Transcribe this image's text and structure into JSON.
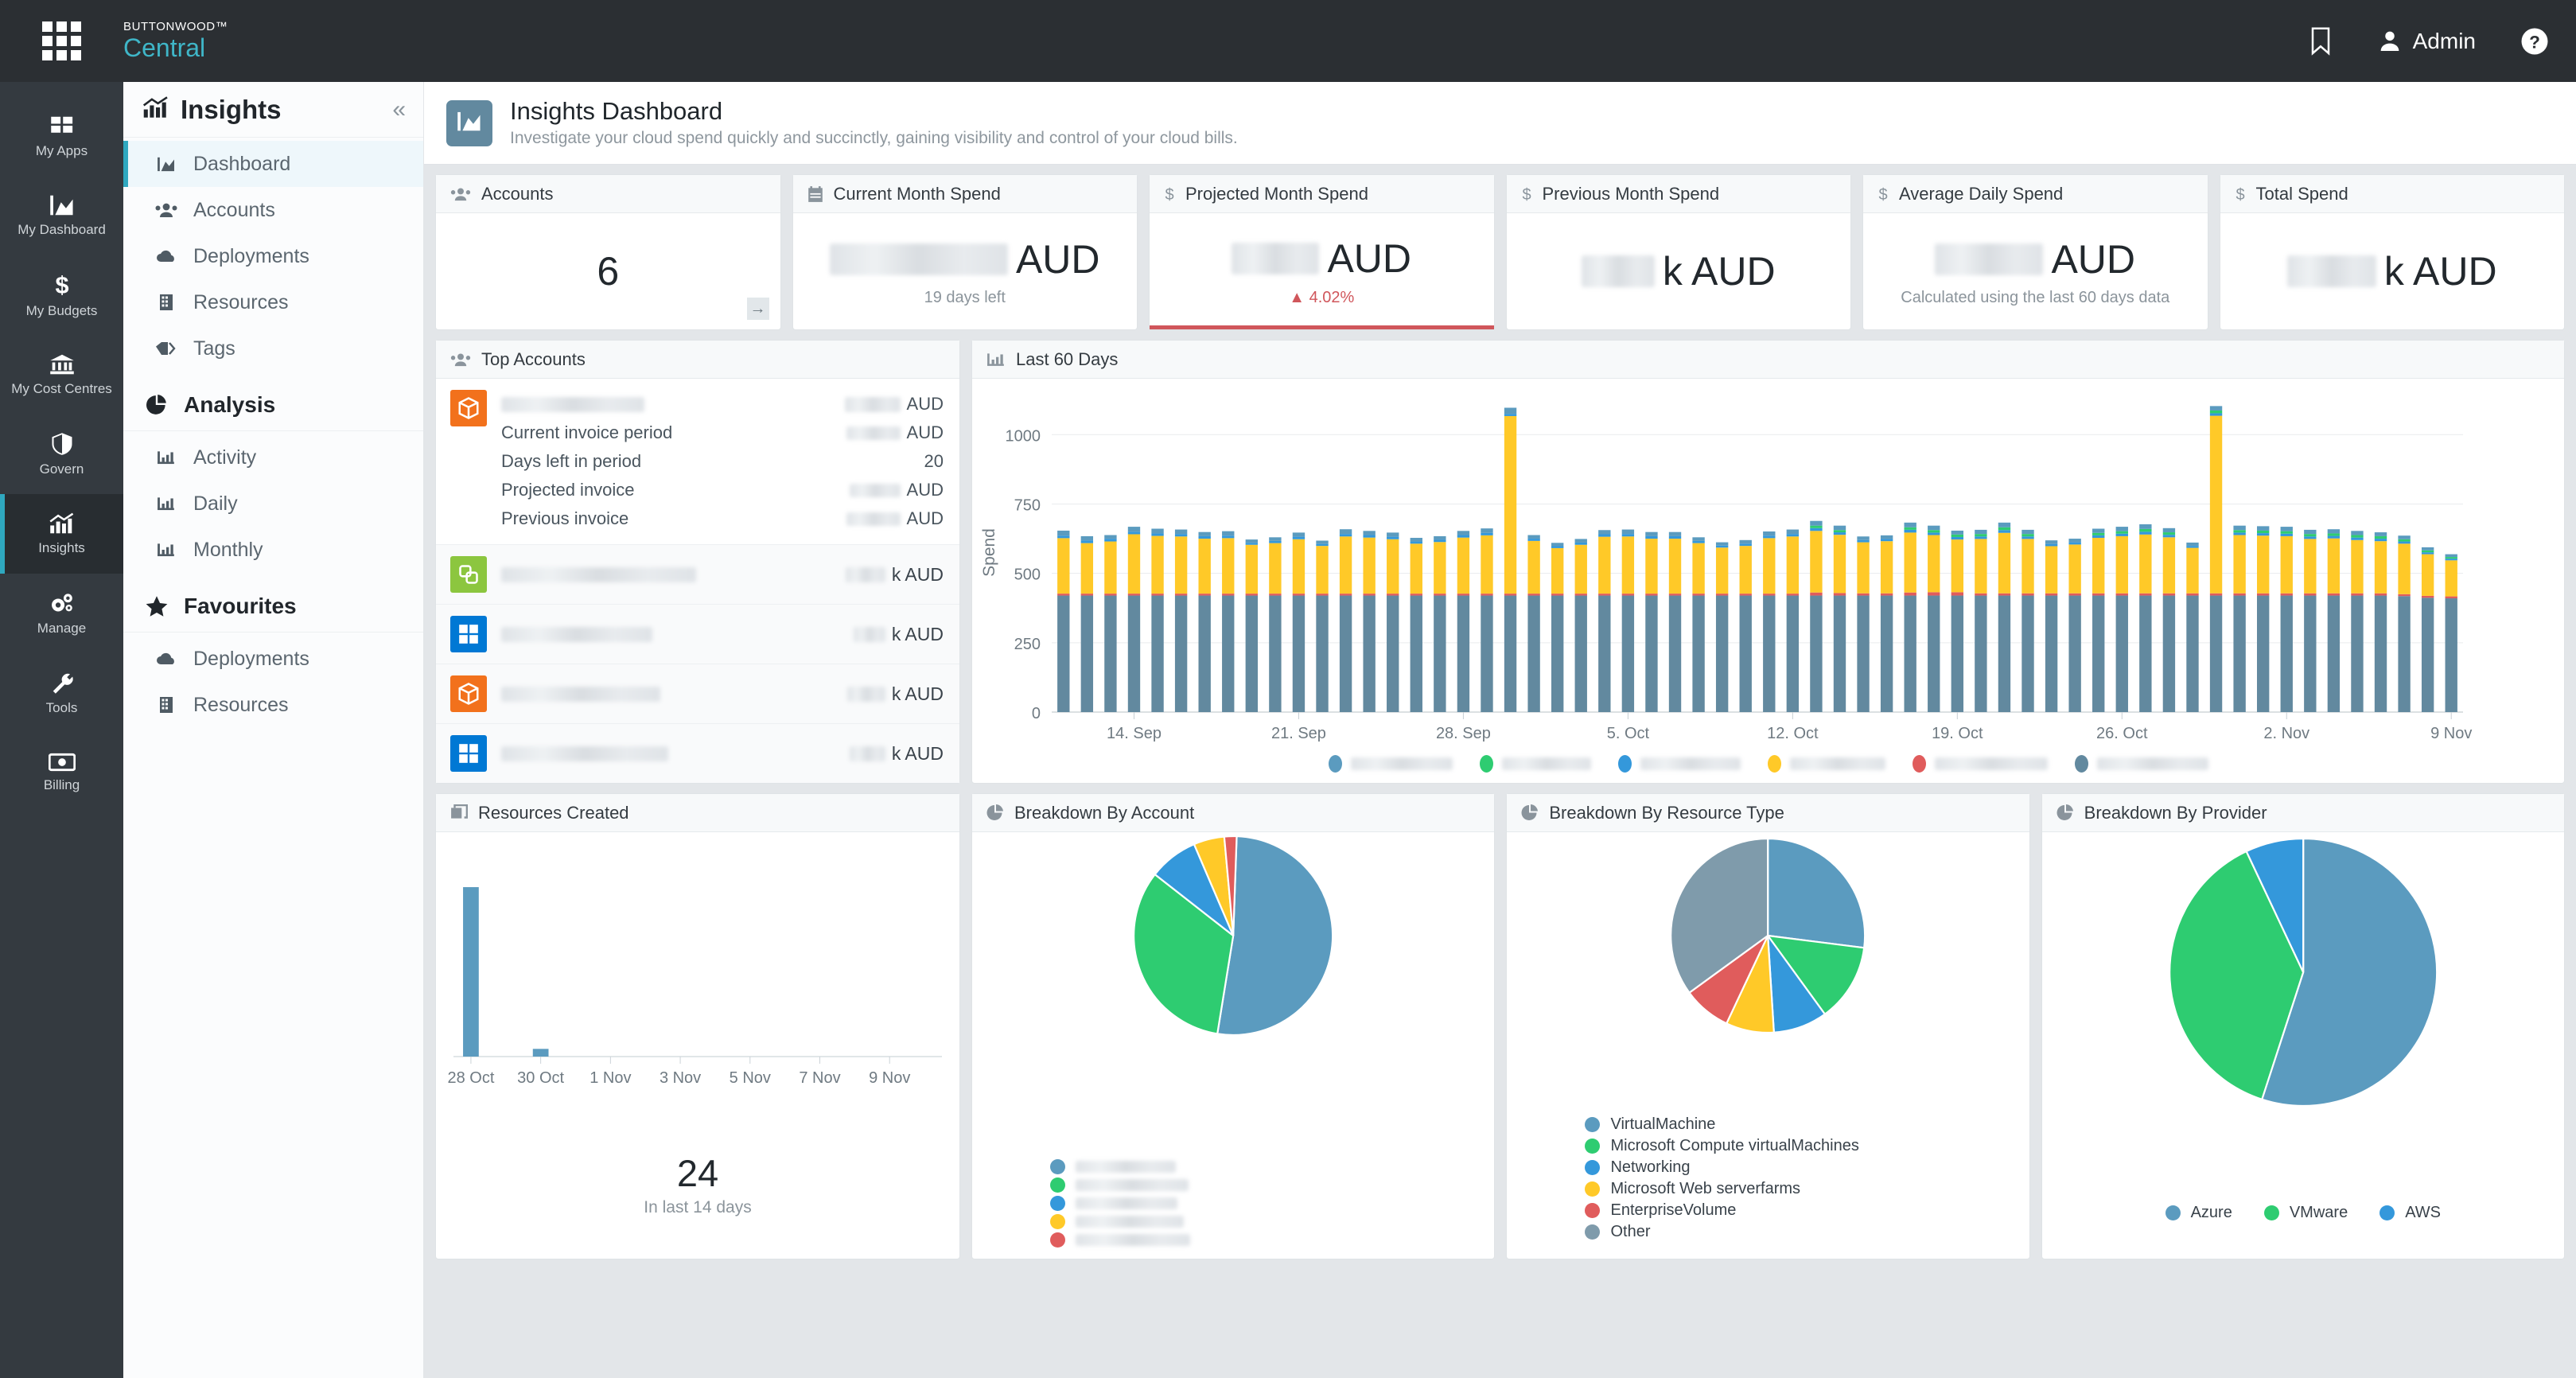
{
  "topbar": {
    "brand_top": "BUTTONWOOD™",
    "brand_main": "Central",
    "bookmark_label": "bookmark-icon",
    "user_label": "Admin",
    "help_label": "help-icon"
  },
  "rail": {
    "items": [
      {
        "label": "My Apps",
        "icon": "apps-icon",
        "active": false
      },
      {
        "label": "My Dashboard",
        "icon": "area-chart-icon",
        "active": false
      },
      {
        "label": "My Budgets",
        "icon": "dollar-icon",
        "active": false
      },
      {
        "label": "My Cost Centres",
        "icon": "bank-icon",
        "active": false
      },
      {
        "label": "Govern",
        "icon": "shield-icon",
        "active": false
      },
      {
        "label": "Insights",
        "icon": "bar-chart-icon",
        "active": true
      },
      {
        "label": "Manage",
        "icon": "gears-icon",
        "active": false
      },
      {
        "label": "Tools",
        "icon": "wrench-icon",
        "active": false
      },
      {
        "label": "Billing",
        "icon": "money-icon",
        "active": false
      }
    ]
  },
  "sidebar": {
    "title": "Insights",
    "collapse_glyph": "«",
    "items": [
      {
        "label": "Dashboard",
        "icon": "area-chart-icon",
        "active": true
      },
      {
        "label": "Accounts",
        "icon": "users-icon",
        "active": false
      },
      {
        "label": "Deployments",
        "icon": "cloud-icon",
        "active": false
      },
      {
        "label": "Resources",
        "icon": "building-icon",
        "active": false
      },
      {
        "label": "Tags",
        "icon": "tags-icon",
        "active": false
      }
    ],
    "analysis": {
      "title": "Analysis",
      "icon": "pie-chart-icon",
      "items": [
        {
          "label": "Activity",
          "icon": "bar-chart-icon"
        },
        {
          "label": "Daily",
          "icon": "bar-chart-icon"
        },
        {
          "label": "Monthly",
          "icon": "bar-chart-icon"
        }
      ]
    },
    "favourites": {
      "title": "Favourites",
      "icon": "star-icon",
      "items": [
        {
          "label": "Deployments",
          "icon": "cloud-icon"
        },
        {
          "label": "Resources",
          "icon": "building-icon"
        }
      ]
    }
  },
  "page": {
    "title": "Insights Dashboard",
    "subtitle": "Investigate your cloud spend quickly and succinctly, gaining visibility and control of your cloud bills.",
    "icon": "area-chart-icon"
  },
  "kpis": [
    {
      "title": "Accounts",
      "icon": "users-icon",
      "value": "6",
      "redacted": false,
      "sub": "",
      "delta": "",
      "arrow": true
    },
    {
      "title": "Current Month Spend",
      "icon": "calendar-icon",
      "value": "",
      "redacted": true,
      "redacted_width": 224,
      "unit": "AUD",
      "sub": "19 days left",
      "delta": "",
      "arrow": false
    },
    {
      "title": "Projected Month Spend",
      "icon": "dollar-icon",
      "value": "",
      "redacted": true,
      "redacted_width": 110,
      "unit": "AUD",
      "sub": "",
      "delta": "▲ 4.02%",
      "accent": true,
      "arrow": false
    },
    {
      "title": "Previous Month Spend",
      "icon": "dollar-icon",
      "value": "",
      "redacted": true,
      "redacted_width": 92,
      "unit": "k AUD",
      "sub": "",
      "delta": "",
      "arrow": false
    },
    {
      "title": "Average Daily Spend",
      "icon": "dollar-icon",
      "value": "",
      "redacted": true,
      "redacted_width": 136,
      "unit": "AUD",
      "sub": "Calculated using the last 60 days data",
      "delta": "",
      "arrow": false
    },
    {
      "title": "Total Spend",
      "icon": "dollar-icon",
      "value": "",
      "redacted": true,
      "redacted_width": 112,
      "unit": "k AUD",
      "sub": "",
      "delta": "",
      "arrow": false
    }
  ],
  "top_accounts": {
    "title": "Top Accounts",
    "icon": "users-icon",
    "primary": {
      "icon_color": "orange",
      "name_redacted_width": 180,
      "amount_redacted_width": 70,
      "amount_unit": "AUD",
      "details": [
        {
          "label": "Current invoice period",
          "value": "",
          "redacted": true,
          "redacted_width": 68,
          "unit": "AUD"
        },
        {
          "label": "Days left in period",
          "value": "20",
          "redacted": false,
          "unit": ""
        },
        {
          "label": "Projected invoice",
          "value": "",
          "redacted": true,
          "redacted_width": 64,
          "unit": "AUD"
        },
        {
          "label": "Previous invoice",
          "value": "",
          "redacted": true,
          "redacted_width": 68,
          "unit": "AUD"
        }
      ]
    },
    "rows": [
      {
        "icon_color": "green",
        "name_redacted_width": 245,
        "amount_redacted_width": 50,
        "unit": "k AUD"
      },
      {
        "icon_color": "blue",
        "name_redacted_width": 190,
        "amount_redacted_width": 40,
        "unit": "k AUD"
      },
      {
        "icon_color": "orange",
        "name_redacted_width": 200,
        "amount_redacted_width": 48,
        "unit": "k AUD"
      },
      {
        "icon_color": "blue",
        "name_redacted_width": 210,
        "amount_redacted_width": 45,
        "unit": "k AUD"
      }
    ]
  },
  "resources_created": {
    "title": "Resources Created",
    "icon": "copy-icon",
    "count": "24",
    "count_sub": "In last 14 days"
  },
  "breakdown_account": {
    "title": "Breakdown By Account",
    "icon": "pie-chart-icon"
  },
  "breakdown_resource": {
    "title": "Breakdown By Resource Type",
    "icon": "pie-chart-icon"
  },
  "breakdown_provider": {
    "title": "Breakdown By Provider",
    "icon": "pie-chart-icon"
  },
  "chart_data": [
    {
      "id": "last60",
      "type": "bar",
      "stacked": true,
      "title": "Last 60 Days",
      "icon": "bar-chart-icon",
      "xlabel": "",
      "ylabel": "Spend",
      "ylim": [
        0,
        1150
      ],
      "yticks": [
        0,
        250,
        500,
        750,
        1000
      ],
      "grid": true,
      "legend_position": "bottom",
      "legend_redacted": true,
      "legend": [
        {
          "label": "",
          "color": "#5b9bbf",
          "redacted_width": 128
        },
        {
          "label": "",
          "color": "#2ecc71",
          "redacted_width": 112
        },
        {
          "label": "",
          "color": "#3498db",
          "redacted_width": 126
        },
        {
          "label": "",
          "color": "#ffc928",
          "redacted_width": 120
        },
        {
          "label": "",
          "color": "#e05c5c",
          "redacted_width": 142
        },
        {
          "label": "",
          "color": "#62899f",
          "redacted_width": 140
        }
      ],
      "x_tick_labels": [
        "14. Sep",
        "21. Sep",
        "28. Sep",
        "5. Oct",
        "12. Oct",
        "19. Oct",
        "26. Oct",
        "2. Nov",
        "9 Nov"
      ],
      "x_tick_indices": [
        3,
        10,
        17,
        24,
        31,
        38,
        45,
        52,
        59
      ],
      "series": [
        {
          "name": "base",
          "color": "#62899f",
          "values": [
            420,
            420,
            420,
            420,
            420,
            420,
            420,
            420,
            420,
            420,
            420,
            420,
            420,
            420,
            420,
            420,
            420,
            420,
            420,
            420,
            420,
            420,
            420,
            420,
            420,
            420,
            420,
            420,
            420,
            420,
            420,
            420,
            420,
            420,
            420,
            420,
            420,
            420,
            420,
            420,
            420,
            420,
            420,
            420,
            420,
            420,
            420,
            420,
            420,
            420,
            420,
            420,
            420,
            420,
            420,
            420,
            420,
            418,
            412,
            410
          ]
        },
        {
          "name": "enterprise",
          "color": "#e05c5c",
          "values": [
            7,
            7,
            7,
            7,
            7,
            7,
            7,
            7,
            7,
            7,
            7,
            7,
            7,
            7,
            7,
            7,
            7,
            7,
            7,
            7,
            7,
            7,
            7,
            7,
            7,
            7,
            7,
            7,
            7,
            7,
            7,
            7,
            11,
            9,
            8,
            8,
            11,
            12,
            12,
            8,
            8,
            8,
            8,
            8,
            8,
            8,
            8,
            8,
            8,
            8,
            8,
            8,
            8,
            8,
            8,
            8,
            8,
            7,
            7,
            7
          ]
        },
        {
          "name": "web",
          "color": "#ffc928",
          "values": [
            200,
            182,
            188,
            214,
            208,
            206,
            198,
            200,
            176,
            182,
            196,
            172,
            206,
            202,
            196,
            180,
            186,
            202,
            210,
            640,
            190,
            164,
            176,
            205,
            206,
            198,
            198,
            182,
            166,
            172,
            200,
            206,
            222,
            210,
            184,
            188,
            216,
            206,
            190,
            196,
            218,
            196,
            170,
            176,
            200,
            206,
            212,
            202,
            164,
            640,
            210,
            208,
            206,
            196,
            198,
            192,
            188,
            182,
            150,
            130
          ]
        },
        {
          "name": "networking",
          "color": "#3498db",
          "values": [
            9,
            10,
            9,
            9,
            9,
            9,
            9,
            9,
            7,
            8,
            9,
            7,
            9,
            9,
            9,
            8,
            8,
            9,
            9,
            8,
            8,
            7,
            8,
            9,
            9,
            9,
            9,
            8,
            7,
            8,
            9,
            9,
            10,
            9,
            8,
            8,
            10,
            9,
            9,
            9,
            10,
            9,
            8,
            8,
            9,
            9,
            10,
            9,
            7,
            9,
            9,
            9,
            9,
            9,
            9,
            9,
            9,
            8,
            7,
            6
          ]
        },
        {
          "name": "compute",
          "color": "#2ecc71",
          "values": [
            0,
            0,
            0,
            0,
            0,
            0,
            0,
            0,
            0,
            0,
            0,
            0,
            0,
            0,
            0,
            0,
            0,
            0,
            0,
            0,
            0,
            0,
            0,
            0,
            0,
            0,
            0,
            0,
            0,
            0,
            0,
            0,
            9,
            8,
            0,
            0,
            9,
            9,
            9,
            9,
            10,
            9,
            0,
            0,
            9,
            9,
            10,
            9,
            0,
            10,
            9,
            9,
            9,
            9,
            9,
            9,
            9,
            8,
            7,
            6
          ]
        },
        {
          "name": "vm",
          "color": "#5b9bbf",
          "values": [
            18,
            15,
            14,
            18,
            17,
            16,
            15,
            16,
            12,
            13,
            15,
            12,
            17,
            15,
            15,
            13,
            13,
            15,
            16,
            22,
            13,
            12,
            13,
            15,
            16,
            15,
            15,
            13,
            12,
            13,
            15,
            16,
            17,
            16,
            13,
            13,
            17,
            16,
            14,
            15,
            17,
            15,
            13,
            13,
            15,
            16,
            17,
            15,
            12,
            16,
            16,
            16,
            16,
            15,
            15,
            15,
            14,
            13,
            11,
            10
          ]
        }
      ]
    },
    {
      "id": "resources_created",
      "type": "bar",
      "title": "Resources Created",
      "ylim": [
        0,
        25
      ],
      "grid": false,
      "x_tick_labels": [
        "28 Oct",
        "30 Oct",
        "1 Nov",
        "3 Nov",
        "5 Nov",
        "7 Nov",
        "9 Nov"
      ],
      "categories": [
        "28 Oct",
        "29 Oct",
        "30 Oct",
        "31 Oct",
        "1 Nov",
        "2 Nov",
        "3 Nov",
        "4 Nov",
        "5 Nov",
        "6 Nov",
        "7 Nov",
        "8 Nov",
        "9 Nov",
        "10 Nov"
      ],
      "values": [
        22,
        0,
        1,
        0,
        0,
        0,
        0,
        0,
        0,
        0,
        0,
        0,
        0,
        0
      ],
      "color": "#5b9bbf",
      "total": 24,
      "total_label": "In last 14 days"
    },
    {
      "id": "breakdown_account",
      "type": "pie",
      "title": "Breakdown By Account",
      "legend_redacted": true,
      "labels": [
        "",
        "",
        "",
        "",
        ""
      ],
      "values": [
        52,
        33,
        8,
        5,
        2
      ],
      "colors": [
        "#5b9bbf",
        "#2ecc71",
        "#3498db",
        "#ffc928",
        "#e05c5c"
      ],
      "legend_redacted_widths": [
        126,
        142,
        128,
        136,
        144
      ]
    },
    {
      "id": "breakdown_resource",
      "type": "pie",
      "title": "Breakdown By Resource Type",
      "labels": [
        "VirtualMachine",
        "Microsoft Compute virtualMachines",
        "Networking",
        "Microsoft Web serverfarms",
        "EnterpriseVolume",
        "Other"
      ],
      "values": [
        27,
        13,
        9,
        8,
        8,
        35
      ],
      "colors": [
        "#5b9bbf",
        "#2ecc71",
        "#3498db",
        "#ffc928",
        "#e05c5c",
        "#7f9bab"
      ]
    },
    {
      "id": "breakdown_provider",
      "type": "pie",
      "title": "Breakdown By Provider",
      "labels": [
        "Azure",
        "VMware",
        "AWS"
      ],
      "values": [
        55,
        38,
        7
      ],
      "colors": [
        "#5b9bbf",
        "#2ecc71",
        "#3498db"
      ]
    }
  ]
}
